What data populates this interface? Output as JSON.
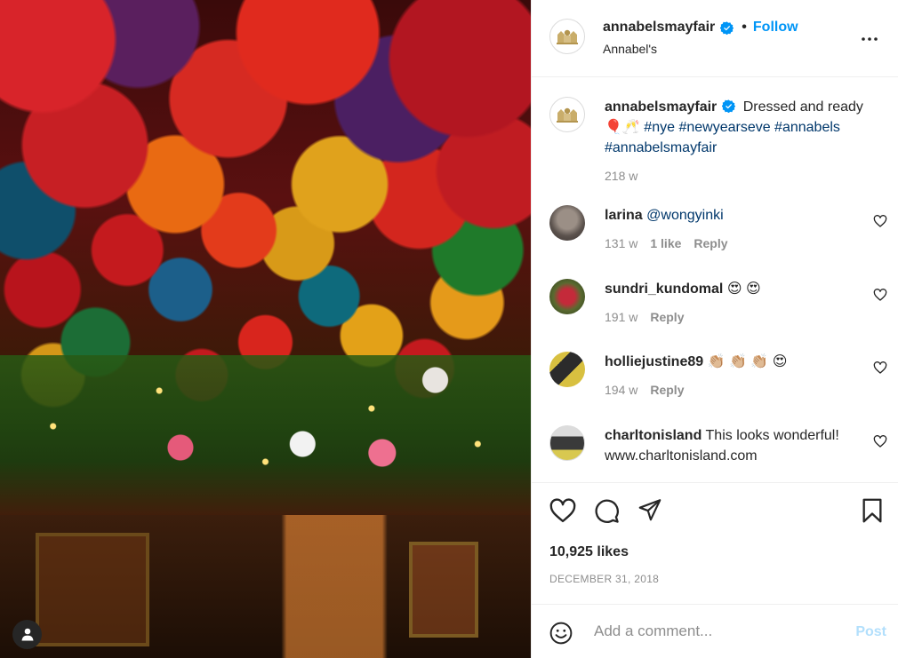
{
  "photo": {
    "alt": ""
  },
  "header": {
    "username": "annabelsmayfair",
    "follow_label": "Follow",
    "location": "Annabel's"
  },
  "caption": {
    "username": "annabelsmayfair",
    "text": "Dressed and ready 🎈🥂",
    "hashtags": "#nye #newyearseve #annabels #annabelsmayfair",
    "time": "218 w"
  },
  "comments": [
    {
      "username": "larina",
      "text_tag": "@wongyinki",
      "text": "",
      "time": "131 w",
      "likes": "1 like",
      "reply": "Reply"
    },
    {
      "username": "sundri_kundomal",
      "text": "😍 😍",
      "time": "191 w",
      "reply": "Reply"
    },
    {
      "username": "holliejustine89",
      "text": "👏🏼 👏🏼 👏🏼 😍",
      "time": "194 w",
      "reply": "Reply"
    },
    {
      "username": "charltonisland",
      "text": "This looks wonderful! www.charltonisland.com"
    }
  ],
  "post": {
    "likes": "10,925 likes",
    "date": "DECEMBER 31, 2018"
  },
  "composer": {
    "placeholder": "Add a comment...",
    "post_label": "Post"
  },
  "colors": {
    "link": "#0095f6",
    "hashtag": "#00376b",
    "muted": "#8e8e8e",
    "post_disabled": "#b2dffc"
  }
}
